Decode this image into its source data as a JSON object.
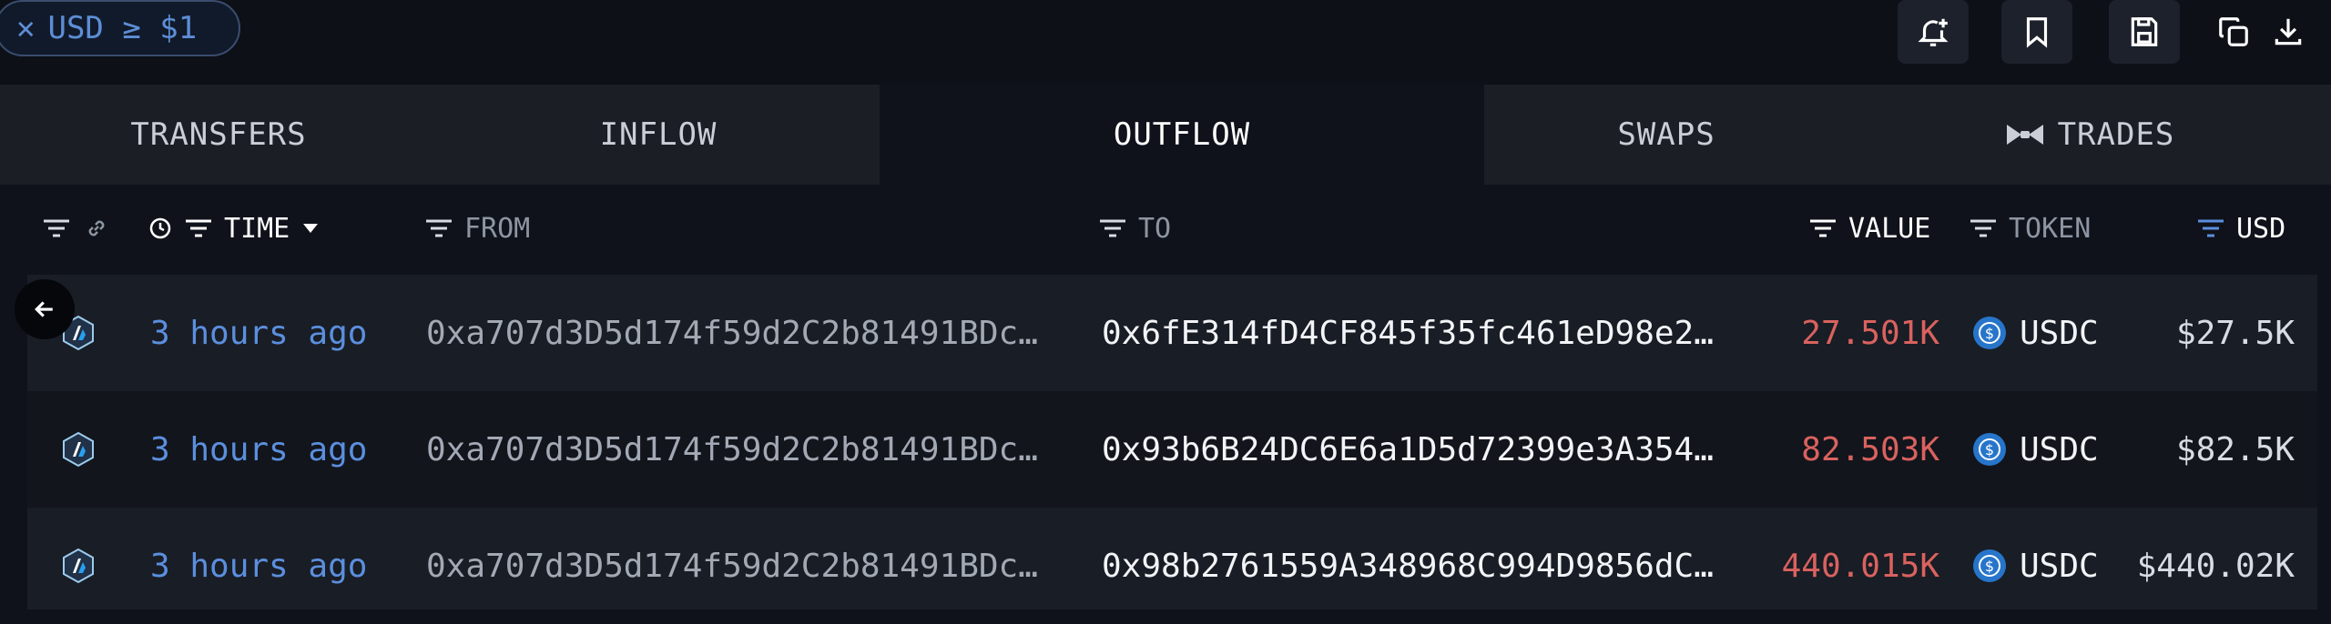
{
  "filter_chip": {
    "close_glyph": "✕",
    "label": "USD ≥ $1"
  },
  "toolbar": {
    "icons": [
      "bell-plus-icon",
      "bookmark-icon",
      "save-icon",
      "copy-icon",
      "download-icon"
    ]
  },
  "tabs": [
    {
      "label": "TRANSFERS"
    },
    {
      "label": "INFLOW"
    },
    {
      "label": "OUTFLOW",
      "active": true
    },
    {
      "label": "SWAPS"
    },
    {
      "label": "TRADES"
    }
  ],
  "columns": {
    "time": "TIME",
    "from": "FROM",
    "to": "TO",
    "value": "VALUE",
    "token": "TOKEN",
    "usd": "USD"
  },
  "rows": [
    {
      "time": "3 hours ago",
      "from": "0xa707d3D5d174f59d2C2b81491BDc…",
      "to": "0x6fE314fD4CF845f35fc461eD98e2…",
      "value": "27.501K",
      "token": "USDC",
      "usd": "$27.5K"
    },
    {
      "time": "3 hours ago",
      "from": "0xa707d3D5d174f59d2C2b81491BDc…",
      "to": "0x93b6B24DC6E6a1D5d72399e3A354…",
      "value": "82.503K",
      "token": "USDC",
      "usd": "$82.5K"
    },
    {
      "time": "3 hours ago",
      "from": "0xa707d3D5d174f59d2C2b81491BDc…",
      "to": "0x98b2761559A348968C994D9856dC…",
      "value": "440.015K",
      "token": "USDC",
      "usd": "$440.02K"
    }
  ],
  "colors": {
    "accent_blue": "#5b8fde",
    "value_red": "#d9625f",
    "usdc_blue": "#2775ca"
  }
}
